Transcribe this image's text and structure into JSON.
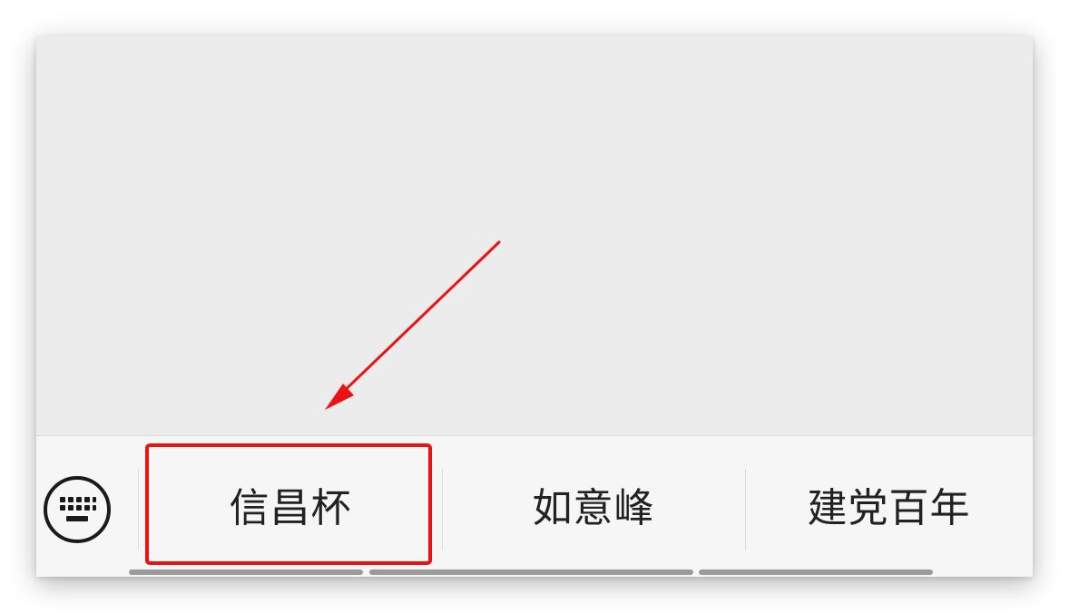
{
  "suggestions": [
    {
      "label": "信昌杯"
    },
    {
      "label": "如意峰"
    },
    {
      "label": "建党百年"
    }
  ],
  "icons": {
    "keyboard": "keyboard-icon",
    "arrow": "arrow-annotation"
  },
  "colors": {
    "background": "#ececec",
    "bar": "#f6f6f6",
    "highlight": "#ee1111",
    "text": "#222222",
    "scrollbar": "#9b9b9b"
  }
}
